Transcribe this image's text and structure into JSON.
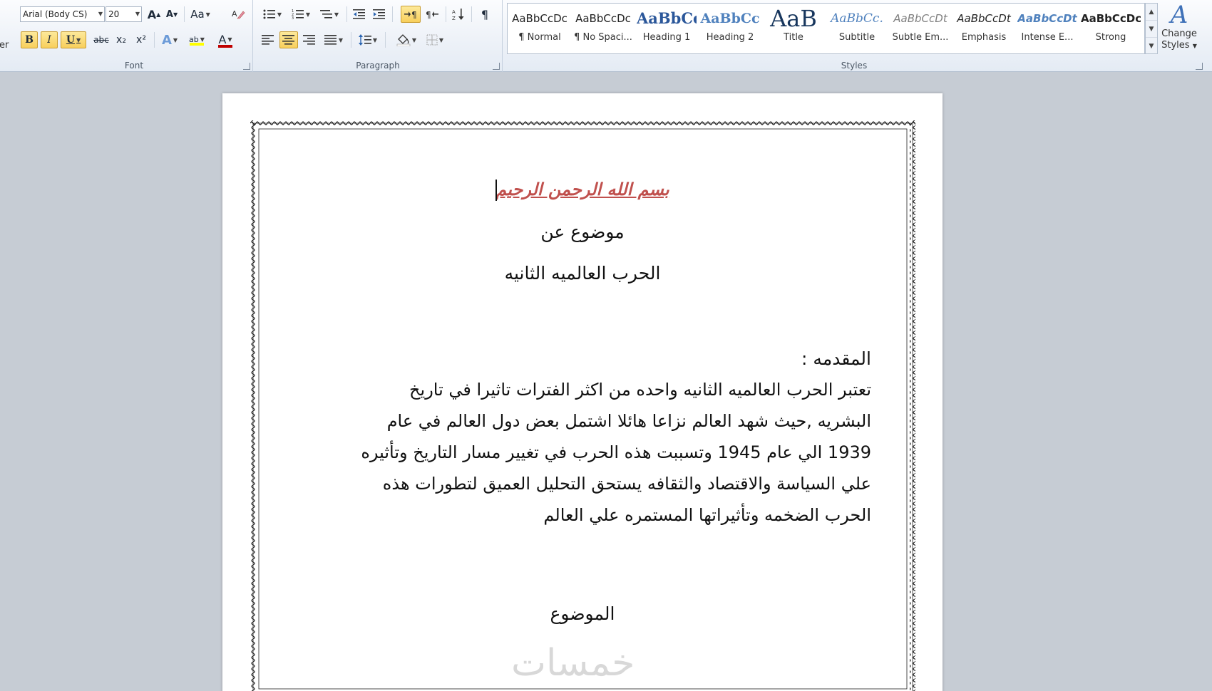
{
  "ribbon": {
    "clipped_label": "er",
    "font": {
      "family": "Arial (Body CS)",
      "size": "20",
      "group_label": "Font",
      "grow": "A",
      "shrink": "A",
      "change_case": "Aa",
      "bold": "B",
      "italic": "I",
      "underline": "U",
      "strike": "abc",
      "subscript": "x₂",
      "superscript": "x²",
      "text_effects": "A",
      "highlight": "ab",
      "font_color": "A",
      "font_color_hex": "#c00000",
      "highlight_hex": "#ffff00"
    },
    "paragraph": {
      "group_label": "Paragraph",
      "pilcrow": "¶"
    },
    "styles": {
      "group_label": "Styles",
      "items": [
        {
          "sample": "AaBbCcDc",
          "name": "¶ Normal"
        },
        {
          "sample": "AaBbCcDc",
          "name": "¶ No Spaci..."
        },
        {
          "sample": "AaBbCc",
          "name": "Heading 1"
        },
        {
          "sample": "AaBbCc",
          "name": "Heading 2"
        },
        {
          "sample": "AaB",
          "name": "Title"
        },
        {
          "sample": "AaBbCc.",
          "name": "Subtitle"
        },
        {
          "sample": "AaBbCcDt",
          "name": "Subtle Em..."
        },
        {
          "sample": "AaBbCcDt",
          "name": "Emphasis"
        },
        {
          "sample": "AaBbCcDt",
          "name": "Intense E..."
        },
        {
          "sample": "AaBbCcDc",
          "name": "Strong"
        }
      ],
      "change_styles_label_1": "Change",
      "change_styles_label_2": "Styles"
    }
  },
  "document": {
    "basmala": "بسم الله الرحمن الرحيم",
    "title_line1": "موضوع عن",
    "title_line2": "الحرب العالميه الثانيه",
    "intro_heading": "المقدمه :",
    "paragraph_lines": [
      "تعتبر الحرب العالميه الثانيه واحده من اكثر الفترات تاثيرا في تاريخ",
      "البشريه ,حيث شهد العالم نزاعا هائلا اشتمل بعض دول العالم في عام",
      "1939 الي عام 1945 وتسببت هذه الحرب في تغيير مسار التاريخ وتأثيره",
      "علي السياسة والاقتصاد والثقافه يستحق التحليل العميق لتطورات هذه",
      "الحرب الضخمه وتأثيراتها المستمره علي العالم"
    ],
    "section_heading": "الموضوع",
    "watermark": "خمسات"
  }
}
